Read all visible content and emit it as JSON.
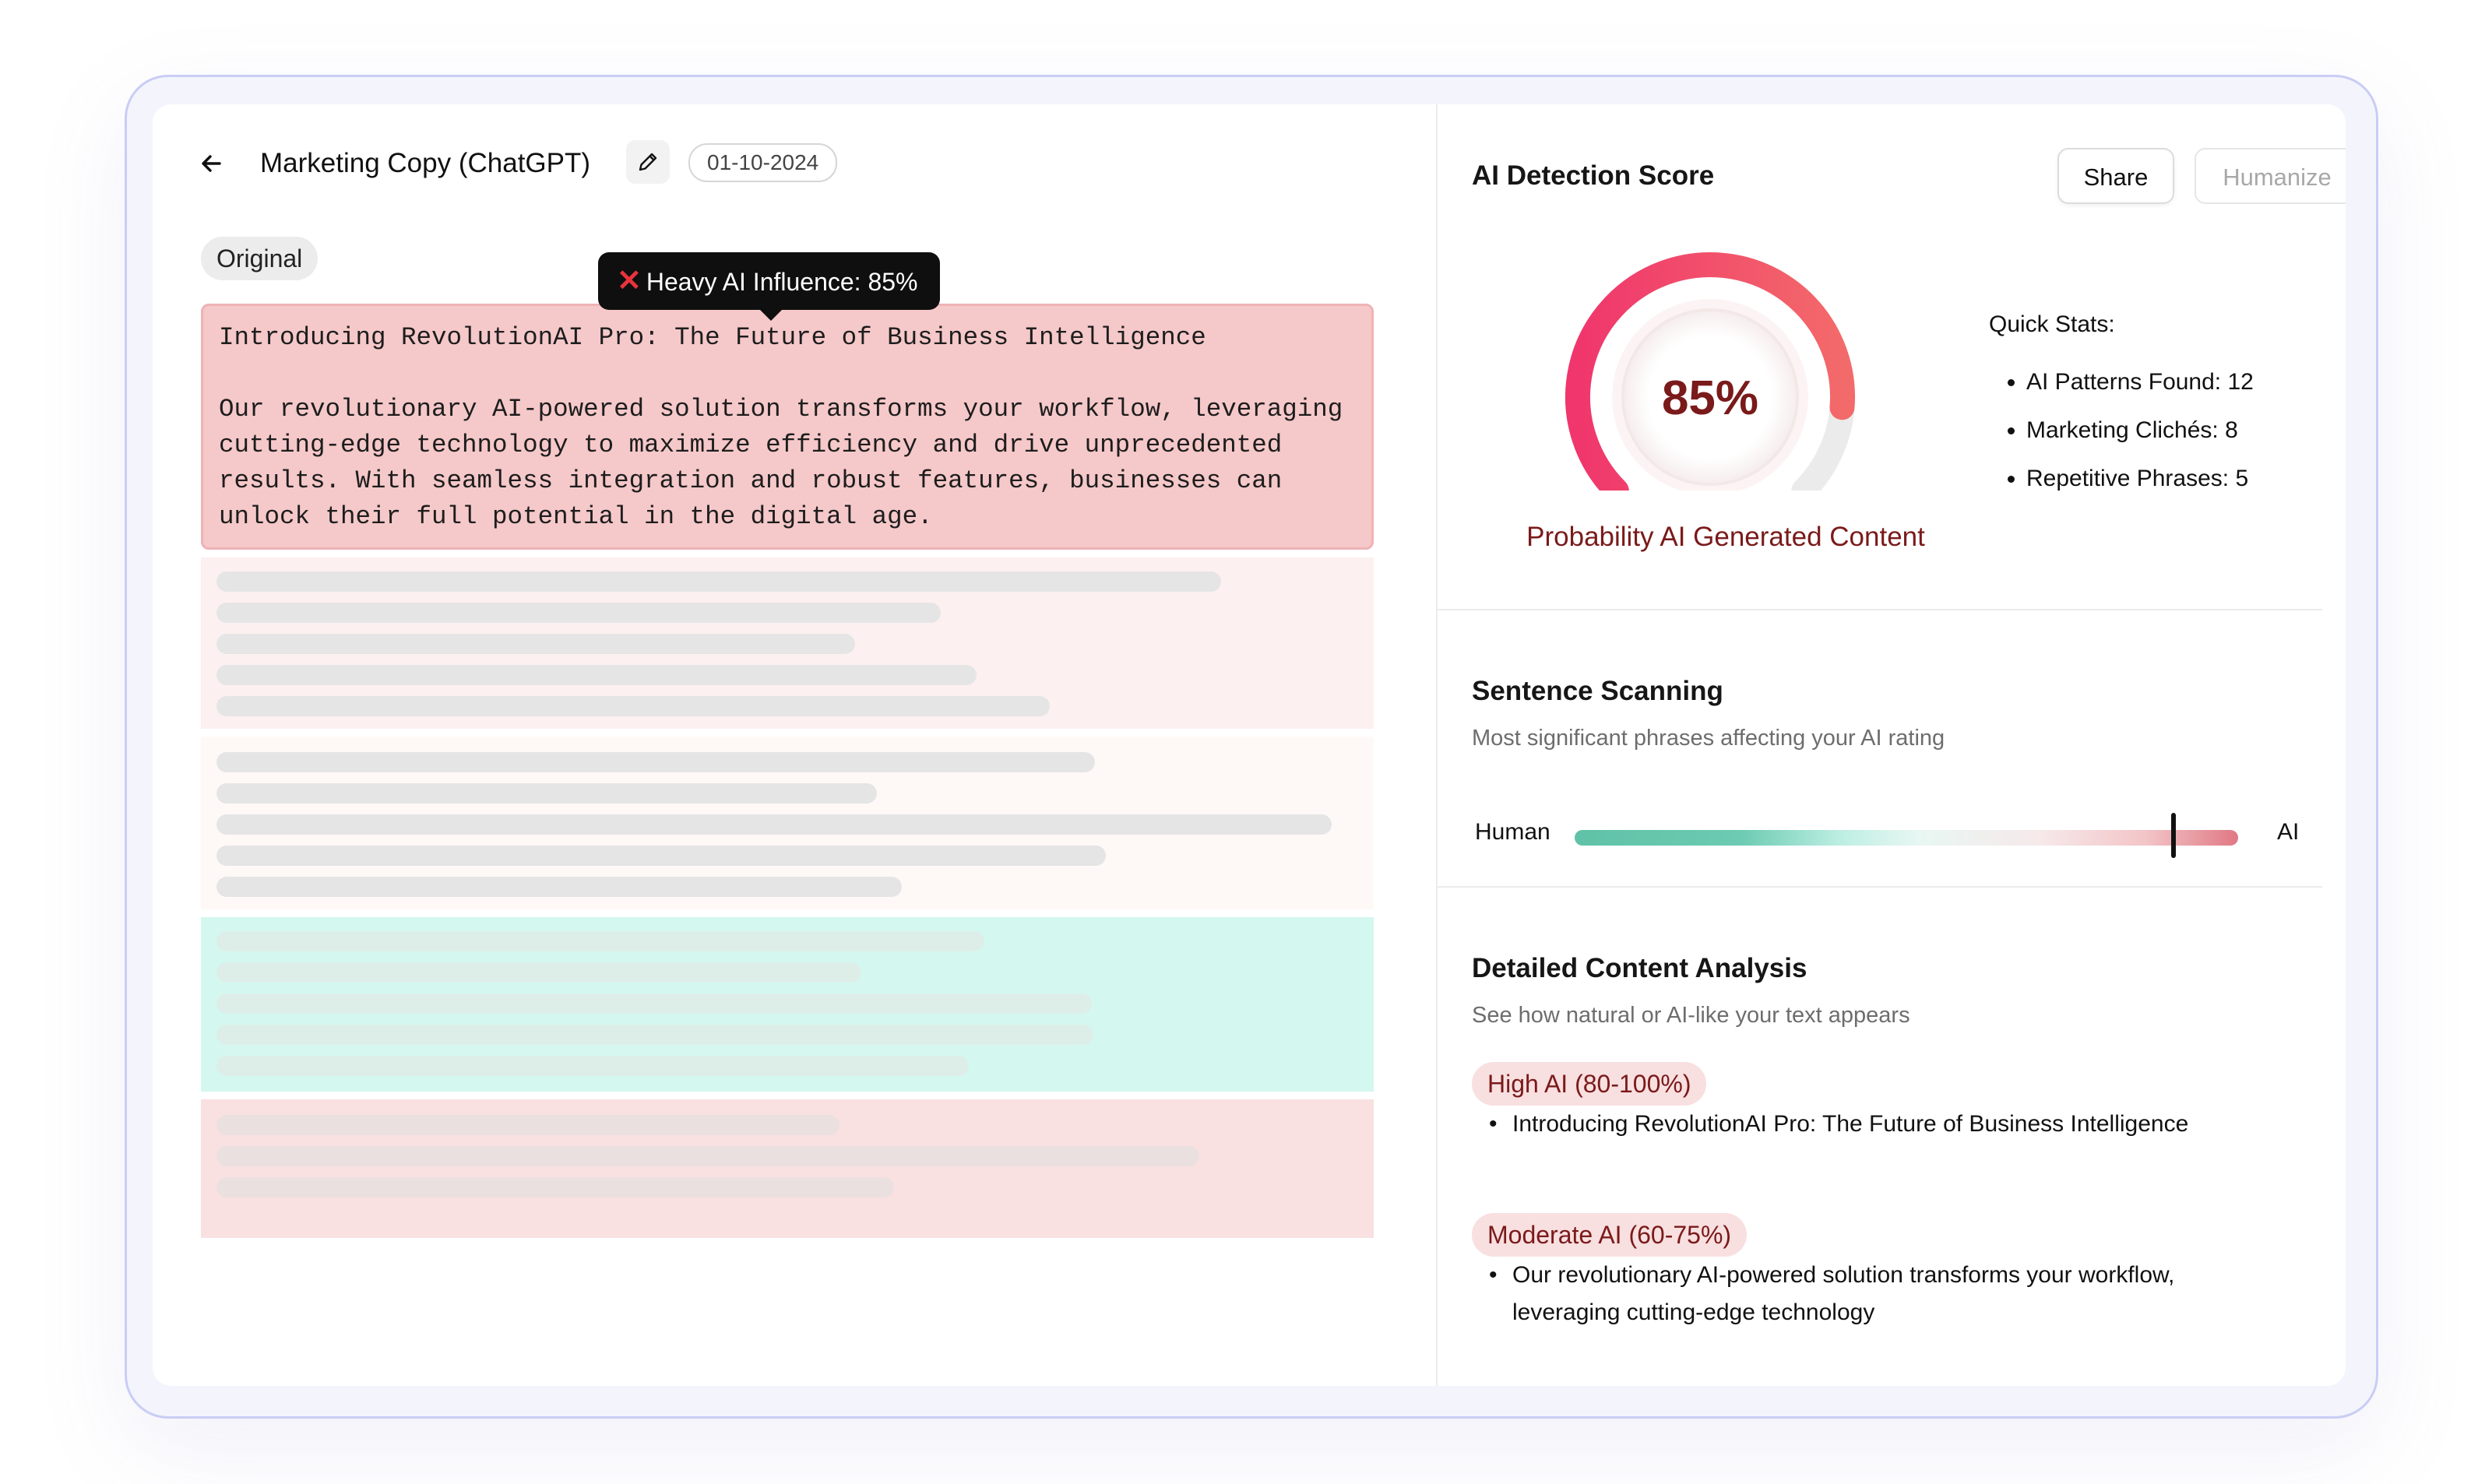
{
  "header": {
    "title": "Marketing Copy (ChatGPT)",
    "date": "01-10-2024"
  },
  "editor": {
    "tag": "Original",
    "tooltip": "Heavy AI Influence: 85%",
    "heading": "Introducing RevolutionAI Pro: The Future of Business Intelligence",
    "body": "Our revolutionary AI-powered solution transforms your workflow, leveraging cutting-edge technology to maximize efficiency and drive unprecedented results. With seamless integration and robust features, businesses can unlock their full potential in the digital age.",
    "block_colors": {
      "main": "#f5c8c9",
      "pink_light": "#fcf1f0",
      "peach_light": "#fef9f7",
      "mint": "#d4f7ef",
      "pink": "#f9e0e1"
    }
  },
  "detection": {
    "title": "AI Detection Score",
    "share_label": "Share",
    "humanize_label": "Humanize",
    "score_value": 0.85,
    "score_text": "85%",
    "score_label": "Probability AI Generated Content",
    "stats_title": "Quick Stats:",
    "stats": [
      "AI Patterns Found: 12",
      "Marketing Clichés: 8",
      "Repetitive Phrases: 5"
    ],
    "colors": {
      "gauge_start": "#f0366c",
      "gauge_end": "#f36a6a",
      "score_text": "#7a1a1a"
    }
  },
  "scanning": {
    "title": "Sentence Scanning",
    "subtitle": "Most significant phrases affecting your AI rating",
    "left_label": "Human",
    "right_label": "AI",
    "position": 0.9
  },
  "analysis": {
    "title": "Detailed Content Analysis",
    "subtitle": "See how natural or AI-like your text appears",
    "levels": [
      {
        "label": "High AI (80-100%)",
        "items": [
          "Introducing RevolutionAI Pro: The Future of Business Intelligence"
        ]
      },
      {
        "label": "Moderate AI (60-75%)",
        "items": [
          "Our revolutionary AI-powered solution transforms your workflow, leveraging cutting-edge technology"
        ]
      }
    ]
  }
}
